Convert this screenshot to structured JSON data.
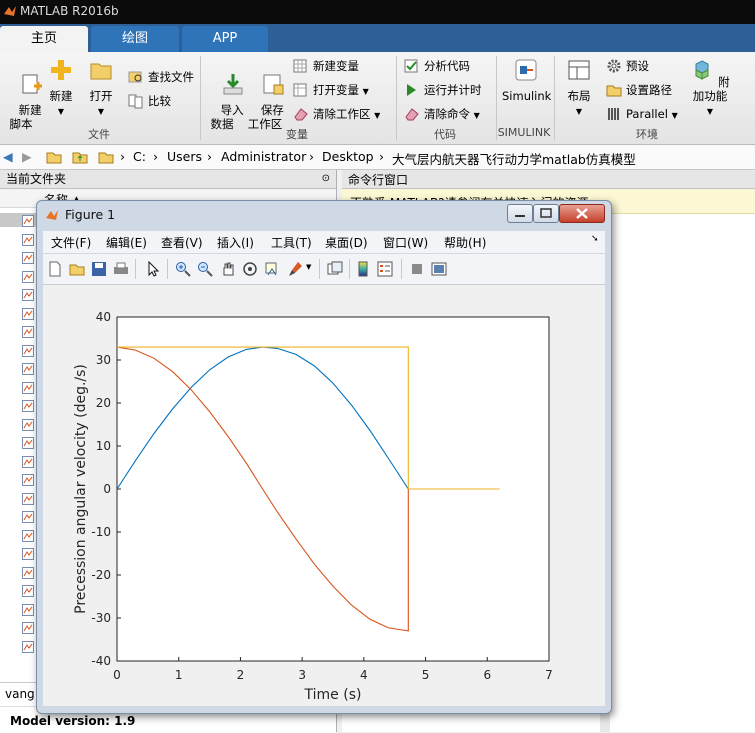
{
  "window": {
    "title": "MATLAB R2016b"
  },
  "tabs": [
    {
      "label": "主页"
    },
    {
      "label": "绘图"
    },
    {
      "label": "APP"
    }
  ],
  "ribbon": {
    "file": {
      "new_script": "新建\n脚本",
      "new": "新建",
      "open": "打开",
      "find_files": "查找文件",
      "compare": "比较",
      "section": "文件"
    },
    "variable": {
      "import": "导入\n数据",
      "save_ws": "保存\n工作区",
      "new_var": "新建变量",
      "open_var": "打开变量",
      "clear_ws": "清除工作区",
      "section": "变量"
    },
    "code": {
      "analyze": "分析代码",
      "run_time": "运行并计时",
      "clear_cmd": "清除命令",
      "section": "代码"
    },
    "simulink": {
      "label": "Simulink",
      "section": "SIMULINK"
    },
    "env": {
      "layout": "布局",
      "prefs": "预设",
      "set_path": "设置路径",
      "parallel": "Parallel",
      "addons": "附加功能",
      "section": "环境"
    }
  },
  "address": {
    "crumbs": [
      "C:",
      "Users",
      "Administrator",
      "Desktop",
      "大气层内航天器飞行动力学matlab仿真模型"
    ]
  },
  "left_pane": {
    "title": "当前文件夹",
    "col_name": "名称 ▲",
    "partial_file": "vang",
    "model_version": "Model version: 1.9"
  },
  "right_pane": {
    "title": "命令行窗口",
    "banner": "不熟悉 MATLAB?请参阅有关快速入门的资源。"
  },
  "figure": {
    "title": "Figure 1",
    "menus": [
      "文件(F)",
      "编辑(E)",
      "查看(V)",
      "插入(I)",
      "工具(T)",
      "桌面(D)",
      "窗口(W)",
      "帮助(H)"
    ]
  },
  "chart_data": {
    "type": "line",
    "xlabel": "Time (s)",
    "ylabel": "Precession angular velocity (deg./s)",
    "xlim": [
      0,
      7
    ],
    "ylim": [
      -40,
      40
    ],
    "xticks": [
      0,
      1,
      2,
      3,
      4,
      5,
      6,
      7
    ],
    "yticks": [
      -40,
      -30,
      -20,
      -10,
      0,
      10,
      20,
      30,
      40
    ],
    "grid": false,
    "series": [
      {
        "color": "#0072bd",
        "x": [
          0,
          0.3,
          0.6,
          0.9,
          1.2,
          1.5,
          1.8,
          2.1,
          2.36,
          2.6,
          2.9,
          3.2,
          3.5,
          3.8,
          4.1,
          4.4,
          4.72
        ],
        "y": [
          0,
          6.6,
          12.9,
          18.6,
          23.6,
          27.7,
          30.7,
          32.5,
          33,
          32.7,
          31.3,
          28.6,
          24.6,
          19.5,
          13.6,
          7.1,
          0
        ]
      },
      {
        "color": "#d95319",
        "x": [
          0,
          0.3,
          0.6,
          0.9,
          1.2,
          1.5,
          1.8,
          2.1,
          2.36,
          2.6,
          2.9,
          3.2,
          3.5,
          3.8,
          4.1,
          4.4,
          4.72,
          4.72
        ],
        "y": [
          33,
          32.3,
          30.4,
          27.3,
          23.1,
          18.0,
          12.2,
          5.9,
          0,
          -5.4,
          -11.6,
          -17.5,
          -22.6,
          -27.0,
          -30.3,
          -32.3,
          -33,
          0
        ]
      },
      {
        "color": "#edb120",
        "x": [
          0,
          4.72,
          4.72,
          6.2
        ],
        "y": [
          33,
          33,
          0,
          0
        ]
      }
    ]
  }
}
